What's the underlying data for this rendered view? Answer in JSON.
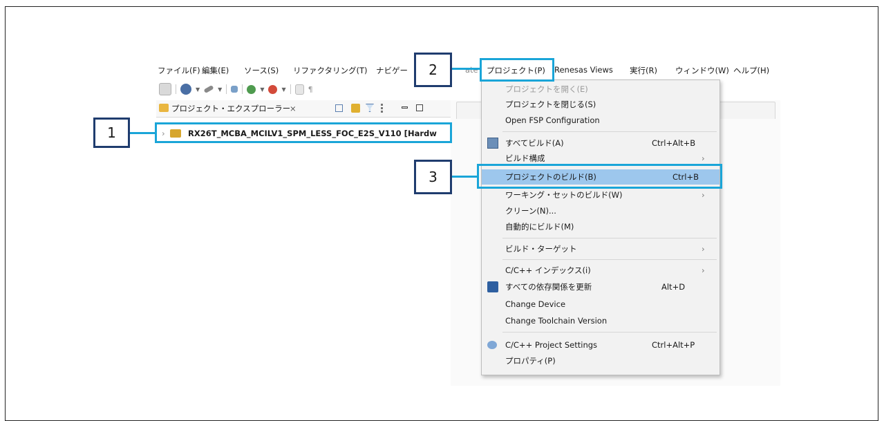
{
  "menubar": {
    "items": [
      "ファイル(F)",
      "編集(E)",
      "ソース(S)",
      "リファクタリング(T)",
      "ナビゲー",
      "プロジェクト(P)",
      "Renesas Views",
      "実行(R)",
      "ウィンドウ(W)",
      "ヘルプ(H)"
    ],
    "partial_hidden": "ate"
  },
  "explorer": {
    "tab_label": "プロジェクト・エクスプローラー",
    "close_glyph": "×",
    "project_name": "RX26T_MCBA_MCILV1_SPM_LESS_FOC_E2S_V110 [Hardw"
  },
  "dropdown": {
    "items": [
      {
        "label": "プロジェクトを開く(E)",
        "shortcut": "",
        "submenu": false,
        "disabled": true
      },
      {
        "label": "プロジェクトを閉じる(S)",
        "shortcut": "",
        "submenu": false
      },
      {
        "label": "Open FSP Configuration",
        "shortcut": "",
        "submenu": false
      },
      {
        "label": "すべてビルド(A)",
        "shortcut": "Ctrl+Alt+B",
        "submenu": false
      },
      {
        "label": "ビルド構成",
        "shortcut": "",
        "submenu": true
      },
      {
        "label": "プロジェクトのビルド(B)",
        "shortcut": "Ctrl+B",
        "submenu": false,
        "highlighted": true
      },
      {
        "label": "ワーキング・セットのビルド(W)",
        "shortcut": "",
        "submenu": true
      },
      {
        "label": "クリーン(N)...",
        "shortcut": "",
        "submenu": false
      },
      {
        "label": "自動的にビルド(M)",
        "shortcut": "",
        "submenu": false
      },
      {
        "label": "ビルド・ターゲット",
        "shortcut": "",
        "submenu": true
      },
      {
        "label": "C/C++ インデックス(i)",
        "shortcut": "",
        "submenu": true
      },
      {
        "label": "すべての依存関係を更新",
        "shortcut": "Alt+D",
        "submenu": false
      },
      {
        "label": "Change Device",
        "shortcut": "",
        "submenu": false
      },
      {
        "label": "Change Toolchain Version",
        "shortcut": "",
        "submenu": false
      },
      {
        "label": "C/C++ Project Settings",
        "shortcut": "Ctrl+Alt+P",
        "submenu": false
      },
      {
        "label": "プロパティ(P)",
        "shortcut": "",
        "submenu": false
      }
    ],
    "arrow_glyph": "›"
  },
  "callouts": {
    "c1": "1",
    "c2": "2",
    "c3": "3"
  },
  "colors": {
    "highlight_box": "#1aa5d8",
    "callout_border": "#1f3c6e",
    "menu_selected": "#9dc7ed"
  }
}
